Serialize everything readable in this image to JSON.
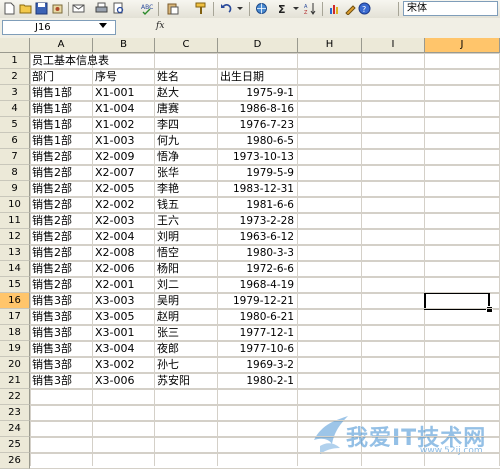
{
  "toolbar": {
    "font_name": "宋体"
  },
  "formula_bar": {
    "name_box": "J16",
    "fx_label": "fx"
  },
  "columns": [
    "A",
    "B",
    "C",
    "D",
    "H",
    "I",
    "J"
  ],
  "selected_column": "J",
  "selected_row": "16",
  "rows": [
    "1",
    "2",
    "3",
    "4",
    "5",
    "6",
    "7",
    "8",
    "9",
    "10",
    "11",
    "12",
    "13",
    "14",
    "15",
    "16",
    "17",
    "18",
    "19",
    "20",
    "21",
    "22",
    "23",
    "24",
    "25",
    "26"
  ],
  "sheet": {
    "title": "员工基本信息表",
    "headers": {
      "dept": "部门",
      "id": "序号",
      "name": "姓名",
      "birth": "出生日期"
    },
    "data": [
      {
        "dept": "销售1部",
        "id": "X1-001",
        "name": "赵大",
        "birth": "1975-9-1"
      },
      {
        "dept": "销售1部",
        "id": "X1-004",
        "name": "唐赛",
        "birth": "1986-8-16"
      },
      {
        "dept": "销售1部",
        "id": "X1-002",
        "name": "李四",
        "birth": "1976-7-23"
      },
      {
        "dept": "销售1部",
        "id": "X1-003",
        "name": "何九",
        "birth": "1980-6-5"
      },
      {
        "dept": "销售2部",
        "id": "X2-009",
        "name": "悟净",
        "birth": "1973-10-13"
      },
      {
        "dept": "销售2部",
        "id": "X2-007",
        "name": "张华",
        "birth": "1979-5-9"
      },
      {
        "dept": "销售2部",
        "id": "X2-005",
        "name": "李艳",
        "birth": "1983-12-31"
      },
      {
        "dept": "销售2部",
        "id": "X2-002",
        "name": "钱五",
        "birth": "1981-6-6"
      },
      {
        "dept": "销售2部",
        "id": "X2-003",
        "name": "王六",
        "birth": "1973-2-28"
      },
      {
        "dept": "销售2部",
        "id": "X2-004",
        "name": "刘明",
        "birth": "1963-6-12"
      },
      {
        "dept": "销售2部",
        "id": "X2-008",
        "name": "悟空",
        "birth": "1980-3-3"
      },
      {
        "dept": "销售2部",
        "id": "X2-006",
        "name": "杨阳",
        "birth": "1972-6-6"
      },
      {
        "dept": "销售2部",
        "id": "X2-001",
        "name": "刘二",
        "birth": "1968-4-19"
      },
      {
        "dept": "销售3部",
        "id": "X3-003",
        "name": "吴明",
        "birth": "1979-12-21"
      },
      {
        "dept": "销售3部",
        "id": "X3-005",
        "name": "赵明",
        "birth": "1980-6-21"
      },
      {
        "dept": "销售3部",
        "id": "X3-001",
        "name": "张三",
        "birth": "1977-12-1"
      },
      {
        "dept": "销售3部",
        "id": "X3-004",
        "name": "夜郎",
        "birth": "1977-10-6"
      },
      {
        "dept": "销售3部",
        "id": "X3-002",
        "name": "孙七",
        "birth": "1969-3-2"
      },
      {
        "dept": "销售3部",
        "id": "X3-006",
        "name": "苏安阳",
        "birth": "1980-2-1"
      }
    ]
  },
  "watermark": {
    "text": "我爱IT技术网",
    "url": "www.52ij.com"
  }
}
